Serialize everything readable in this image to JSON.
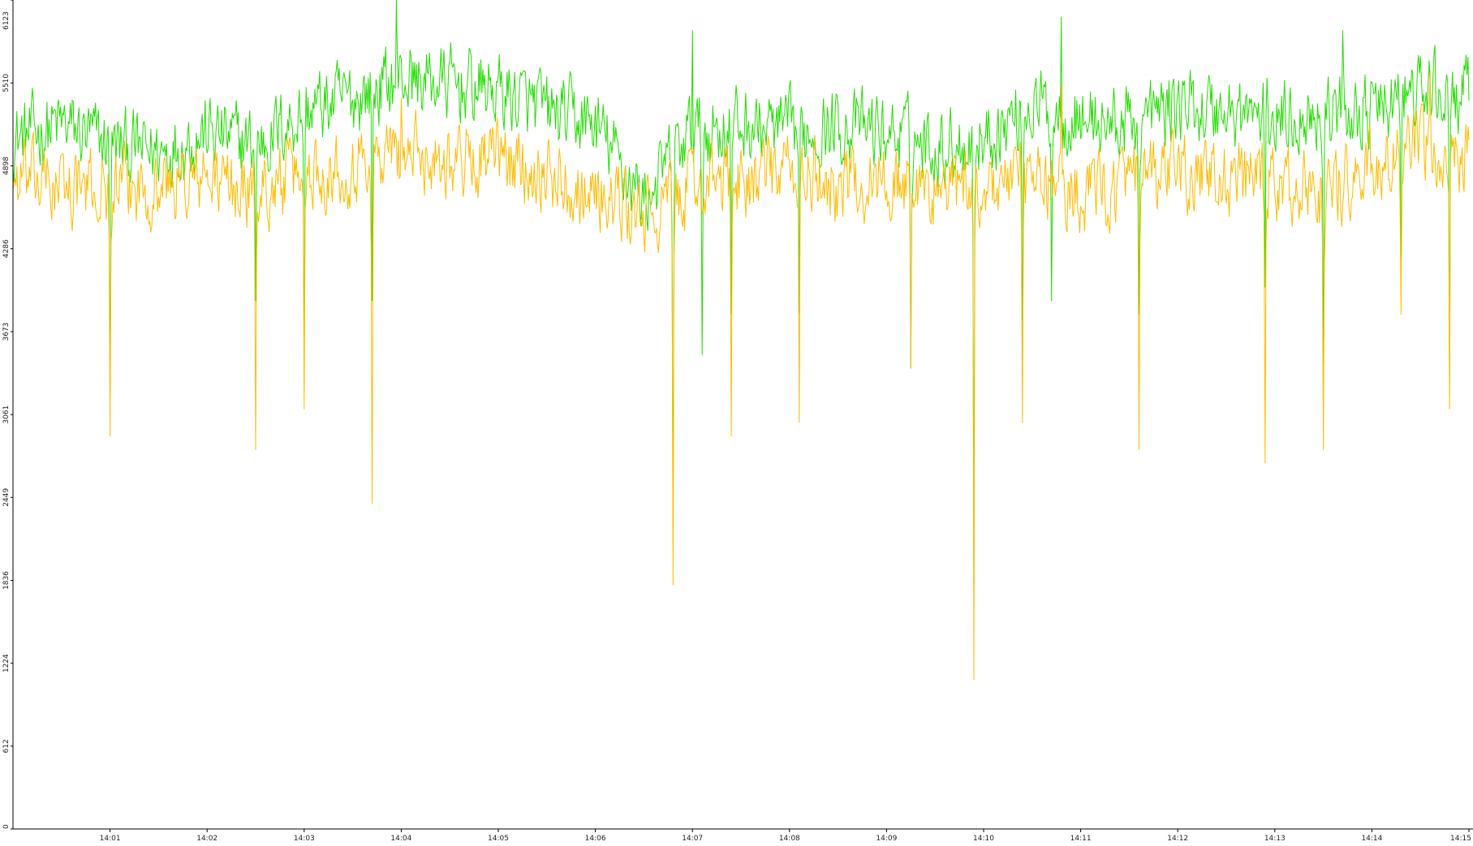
{
  "chart_data": {
    "type": "line",
    "title": "",
    "xlabel": "",
    "ylabel": "",
    "y_ticks": [
      "0",
      "612",
      "1224",
      "1836",
      "2449",
      "3061",
      "3673",
      "4286",
      "4898",
      "5510",
      "6123"
    ],
    "ylim": [
      0,
      6123
    ],
    "x_ticks": [
      "14:01",
      "14:02",
      "14:03",
      "14:04",
      "14:05",
      "14:06",
      "14:07",
      "14:08",
      "14:09",
      "14:10",
      "14:11",
      "14:12",
      "14:13",
      "14:14",
      "14:15"
    ],
    "x_tick_minutes": [
      1,
      2,
      3,
      4,
      5,
      6,
      7,
      8,
      9,
      10,
      11,
      12,
      13,
      14,
      15
    ],
    "xlim_minutes": [
      0.0,
      15.0
    ],
    "grid": false,
    "legend": "none",
    "series": [
      {
        "color": "#22dd00",
        "baseline": 5130,
        "spread": 260,
        "approx_points": [
          [
            0.0,
            5100
          ],
          [
            0.5,
            5200
          ],
          [
            1.0,
            5050
          ],
          [
            1.5,
            5000
          ],
          [
            2.0,
            5150
          ],
          [
            2.5,
            5050
          ],
          [
            3.0,
            5300
          ],
          [
            3.5,
            5400
          ],
          [
            4.0,
            5550
          ],
          [
            4.5,
            5500
          ],
          [
            5.0,
            5450
          ],
          [
            5.5,
            5300
          ],
          [
            6.0,
            5200
          ],
          [
            6.5,
            4650
          ],
          [
            7.0,
            5150
          ],
          [
            7.5,
            5200
          ],
          [
            8.0,
            5150
          ],
          [
            8.5,
            5200
          ],
          [
            9.0,
            5150
          ],
          [
            9.5,
            5050
          ],
          [
            10.0,
            5100
          ],
          [
            10.5,
            5350
          ],
          [
            11.0,
            5250
          ],
          [
            11.5,
            5200
          ],
          [
            12.0,
            5350
          ],
          [
            12.5,
            5300
          ],
          [
            13.0,
            5250
          ],
          [
            13.5,
            5300
          ],
          [
            14.0,
            5300
          ],
          [
            14.5,
            5450
          ],
          [
            15.0,
            5400
          ]
        ],
        "dips": [
          [
            1.0,
            3200
          ],
          [
            2.5,
            3900
          ],
          [
            3.0,
            3300
          ],
          [
            3.7,
            3900
          ],
          [
            6.8,
            2100
          ],
          [
            7.1,
            3500
          ],
          [
            7.4,
            3800
          ],
          [
            8.1,
            3800
          ],
          [
            9.25,
            3400
          ],
          [
            9.9,
            1700
          ],
          [
            10.4,
            3500
          ],
          [
            10.7,
            3900
          ],
          [
            11.6,
            3800
          ],
          [
            12.9,
            4000
          ],
          [
            13.5,
            3300
          ],
          [
            14.3,
            4000
          ],
          [
            14.8,
            3200
          ]
        ],
        "peaks": [
          [
            3.95,
            6123
          ],
          [
            10.8,
            6000
          ],
          [
            7.0,
            5900
          ],
          [
            13.7,
            5900
          ]
        ]
      },
      {
        "color": "#ffbb00",
        "baseline": 4830,
        "spread": 260,
        "approx_points": [
          [
            0.0,
            4800
          ],
          [
            0.5,
            4750
          ],
          [
            1.0,
            4700
          ],
          [
            1.5,
            4750
          ],
          [
            2.0,
            4800
          ],
          [
            2.5,
            4700
          ],
          [
            3.0,
            4850
          ],
          [
            3.5,
            4900
          ],
          [
            4.0,
            5000
          ],
          [
            4.5,
            4950
          ],
          [
            5.0,
            4950
          ],
          [
            5.5,
            4850
          ],
          [
            6.0,
            4700
          ],
          [
            6.5,
            4500
          ],
          [
            7.0,
            4750
          ],
          [
            7.5,
            4800
          ],
          [
            8.0,
            4850
          ],
          [
            8.5,
            4750
          ],
          [
            9.0,
            4800
          ],
          [
            9.5,
            4700
          ],
          [
            10.0,
            4750
          ],
          [
            10.5,
            4800
          ],
          [
            11.0,
            4700
          ],
          [
            11.5,
            4750
          ],
          [
            12.0,
            4850
          ],
          [
            12.5,
            4800
          ],
          [
            13.0,
            4750
          ],
          [
            13.5,
            4700
          ],
          [
            14.0,
            4850
          ],
          [
            14.5,
            5000
          ],
          [
            15.0,
            4950
          ]
        ],
        "dips": [
          [
            1.0,
            2900
          ],
          [
            2.5,
            2800
          ],
          [
            3.0,
            3100
          ],
          [
            3.7,
            2400
          ],
          [
            6.8,
            1800
          ],
          [
            7.4,
            2900
          ],
          [
            8.1,
            3000
          ],
          [
            9.25,
            3400
          ],
          [
            9.9,
            1100
          ],
          [
            10.4,
            3000
          ],
          [
            11.6,
            2800
          ],
          [
            12.9,
            2700
          ],
          [
            13.5,
            2800
          ],
          [
            14.3,
            3800
          ],
          [
            14.8,
            3100
          ]
        ],
        "peaks": [
          [
            4.0,
            5400
          ],
          [
            10.8,
            5500
          ],
          [
            14.6,
            5600
          ]
        ]
      }
    ]
  }
}
